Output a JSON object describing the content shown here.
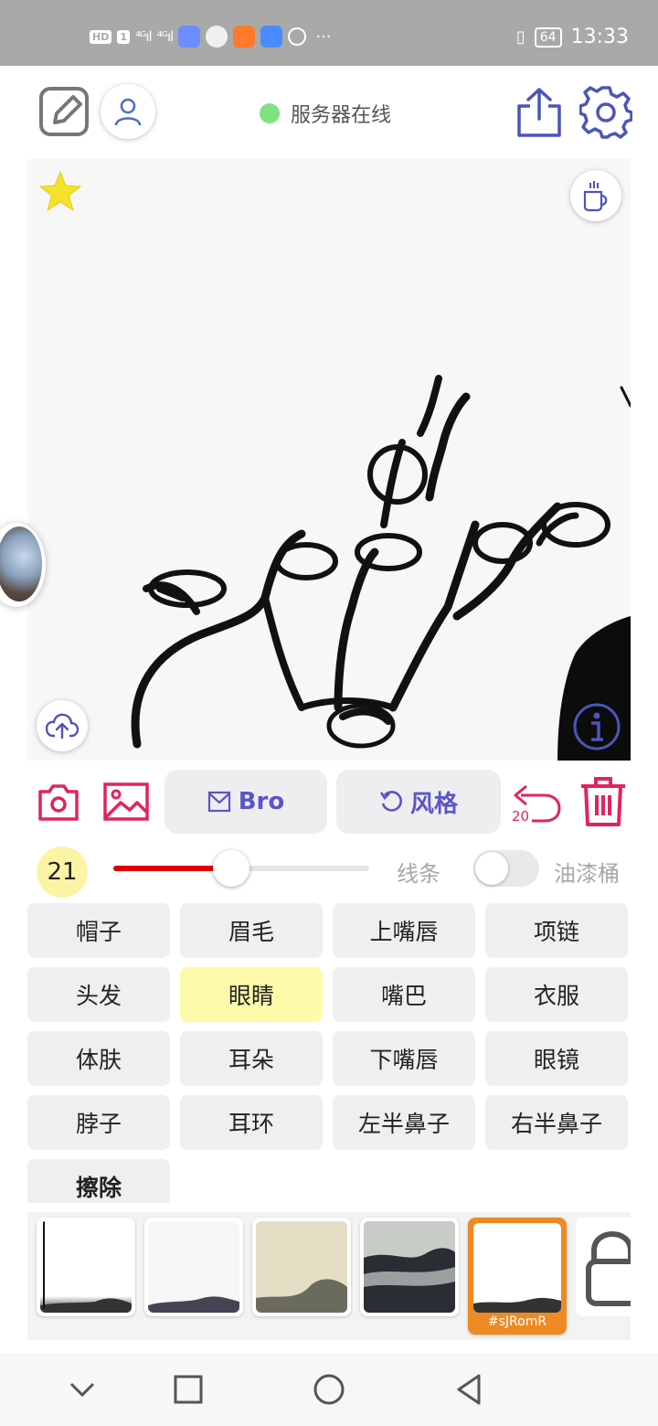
{
  "status_bar": {
    "badge_hd": "HD",
    "badge_sim": "1",
    "signal1": "⁴ᴳıl",
    "signal2": "⁴ᴳıl",
    "more": "···",
    "battery": "64",
    "time": "13:33"
  },
  "header": {
    "server_status": "服务器在线",
    "status_color": "#7ee37e"
  },
  "tools": {
    "bro_label": "Bro",
    "style_label": "风格",
    "undo_count": "20"
  },
  "slider": {
    "size_value": "21",
    "fill_fraction": 0.46,
    "line_label": "线条",
    "bucket_label": "油漆桶",
    "bucket_enabled": false
  },
  "parts": [
    {
      "label": "帽子",
      "selected": false
    },
    {
      "label": "眉毛",
      "selected": false
    },
    {
      "label": "上嘴唇",
      "selected": false
    },
    {
      "label": "项链",
      "selected": false
    },
    {
      "label": "头发",
      "selected": false
    },
    {
      "label": "眼睛",
      "selected": true
    },
    {
      "label": "嘴巴",
      "selected": false
    },
    {
      "label": "衣服",
      "selected": false
    },
    {
      "label": "体肤",
      "selected": false
    },
    {
      "label": "耳朵",
      "selected": false
    },
    {
      "label": "下嘴唇",
      "selected": false
    },
    {
      "label": "眼镜",
      "selected": false
    },
    {
      "label": "脖子",
      "selected": false
    },
    {
      "label": "耳环",
      "selected": false
    },
    {
      "label": "左半鼻子",
      "selected": false
    },
    {
      "label": "右半鼻子",
      "selected": false
    }
  ],
  "erase_label": "擦除",
  "thumbnails": {
    "selected_label": "#sJRomR"
  },
  "colors": {
    "accent": "#5a55c9",
    "danger": "#e0245e",
    "selected_part": "#fdfbaa",
    "selected_thumb": "#ee8a22",
    "slider_fill": "#e00000"
  },
  "icons": [
    "edit-icon",
    "user-icon",
    "share-icon",
    "gear-icon",
    "star-icon",
    "cup-icon",
    "upload-icon",
    "info-icon",
    "camera-icon",
    "image-icon",
    "mail-icon",
    "undo-icon",
    "trash-icon",
    "lock-icon",
    "chevron-down-icon",
    "square-icon",
    "circle-icon",
    "back-icon"
  ]
}
